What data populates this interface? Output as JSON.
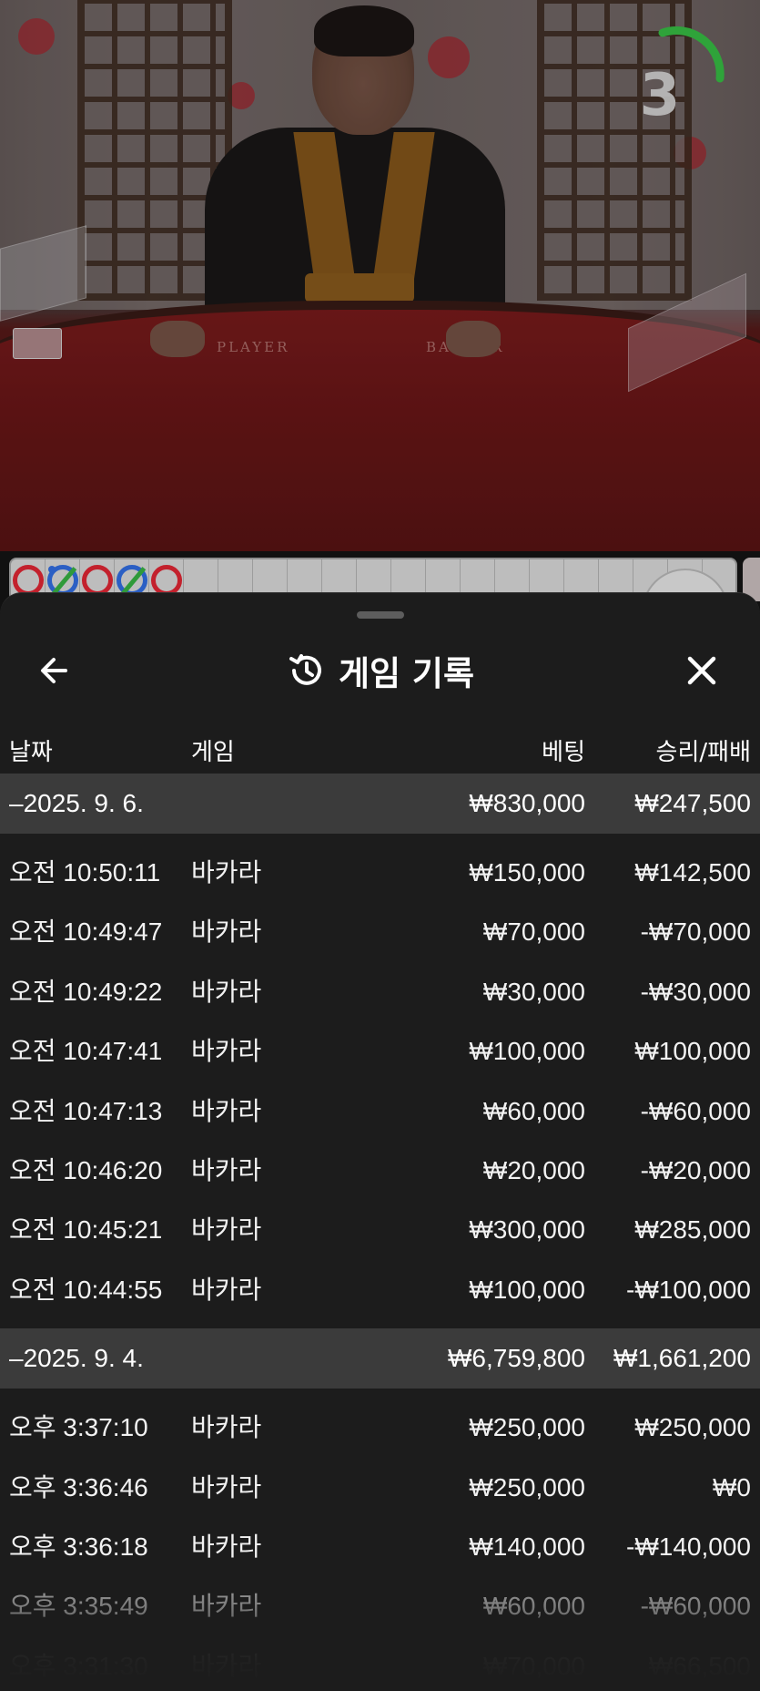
{
  "live": {
    "countdown": "3",
    "table_labels": {
      "player": "PLAYER",
      "banker": "BANKER"
    },
    "ring_color": "#2fa33a"
  },
  "bead_road": [
    {
      "result": "banker",
      "color": "#c3212d"
    },
    {
      "result": "tie",
      "color": "#2b5fc4",
      "pair": true
    },
    {
      "result": "banker",
      "color": "#c3212d"
    },
    {
      "result": "tie",
      "color": "#2b5fc4"
    },
    {
      "result": "banker",
      "color": "#c3212d"
    }
  ],
  "history": {
    "title": "게임 기록",
    "icons": {
      "back": "arrow-left-icon",
      "title": "history-clock-icon",
      "close": "close-icon"
    },
    "columns": {
      "date": "날짜",
      "game": "게임",
      "bet": "베팅",
      "result": "승리/패배"
    },
    "days": [
      {
        "date": "–2025. 9. 6.",
        "total_bet": "₩830,000",
        "total_result": "₩247,500",
        "rows": [
          {
            "time": "오전 10:50:11",
            "game": "바카라",
            "bet": "₩150,000",
            "result": "₩142,500"
          },
          {
            "time": "오전 10:49:47",
            "game": "바카라",
            "bet": "₩70,000",
            "result": "-₩70,000"
          },
          {
            "time": "오전 10:49:22",
            "game": "바카라",
            "bet": "₩30,000",
            "result": "-₩30,000"
          },
          {
            "time": "오전 10:47:41",
            "game": "바카라",
            "bet": "₩100,000",
            "result": "₩100,000"
          },
          {
            "time": "오전 10:47:13",
            "game": "바카라",
            "bet": "₩60,000",
            "result": "-₩60,000"
          },
          {
            "time": "오전 10:46:20",
            "game": "바카라",
            "bet": "₩20,000",
            "result": "-₩20,000"
          },
          {
            "time": "오전 10:45:21",
            "game": "바카라",
            "bet": "₩300,000",
            "result": "₩285,000"
          },
          {
            "time": "오전 10:44:55",
            "game": "바카라",
            "bet": "₩100,000",
            "result": "-₩100,000"
          }
        ]
      },
      {
        "date": "–2025. 9. 4.",
        "total_bet": "₩6,759,800",
        "total_result": "₩1,661,200",
        "rows": [
          {
            "time": "오후 3:37:10",
            "game": "바카라",
            "bet": "₩250,000",
            "result": "₩250,000"
          },
          {
            "time": "오후 3:36:46",
            "game": "바카라",
            "bet": "₩250,000",
            "result": "₩0"
          },
          {
            "time": "오후 3:36:18",
            "game": "바카라",
            "bet": "₩140,000",
            "result": "-₩140,000"
          },
          {
            "time": "오후 3:35:49",
            "game": "바카라",
            "bet": "₩60,000",
            "result": "-₩60,000"
          },
          {
            "time": "오후 3:31:30",
            "game": "바카라",
            "bet": "₩70,000",
            "result": "₩66,500"
          }
        ]
      }
    ]
  }
}
